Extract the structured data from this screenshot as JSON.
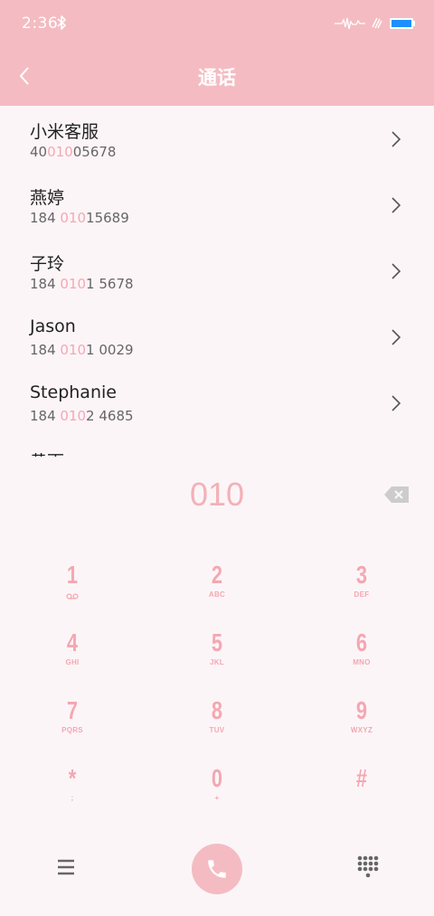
{
  "status": {
    "time": "2:36"
  },
  "appbar": {
    "title": "通话"
  },
  "contacts": [
    {
      "name": "小米客服",
      "number_pre": "40",
      "number_match": "010",
      "number_post": "05678"
    },
    {
      "name": "燕婷",
      "number_pre": "184 ",
      "number_match": "010",
      "number_post": "15689"
    },
    {
      "name": "子玲",
      "number_pre": "184 ",
      "number_match": "010",
      "number_post": "1 5678"
    },
    {
      "name": "Jason",
      "number_pre": "184 ",
      "number_match": "010",
      "number_post": "1 0029"
    },
    {
      "name": "Stephanie",
      "number_pre": "184 ",
      "number_match": "010",
      "number_post": "2 4685"
    },
    {
      "name": "黄雨",
      "number_pre": "",
      "number_match": "",
      "number_post": ""
    }
  ],
  "dialer": {
    "number": "010"
  },
  "keypad": [
    {
      "digit": "1",
      "letters": ""
    },
    {
      "digit": "2",
      "letters": "ABC"
    },
    {
      "digit": "3",
      "letters": "DEF"
    },
    {
      "digit": "4",
      "letters": "GHI"
    },
    {
      "digit": "5",
      "letters": "JKL"
    },
    {
      "digit": "6",
      "letters": "MNO"
    },
    {
      "digit": "7",
      "letters": "PQRS"
    },
    {
      "digit": "8",
      "letters": "TUV"
    },
    {
      "digit": "9",
      "letters": "WXYZ"
    },
    {
      "digit": "*",
      "letters": ";"
    },
    {
      "digit": "0",
      "letters": "+"
    },
    {
      "digit": "#",
      "letters": ""
    }
  ],
  "colors": {
    "header": "#f4bcc2",
    "accent": "#f3a8b1",
    "background": "#fcf5f8",
    "battery": "#1e8fff"
  },
  "icons": {
    "back": "chevron-left-icon",
    "delete": "backspace-icon",
    "call": "phone-icon",
    "menu": "hamburger-menu-icon",
    "keypad": "dialpad-icon"
  }
}
